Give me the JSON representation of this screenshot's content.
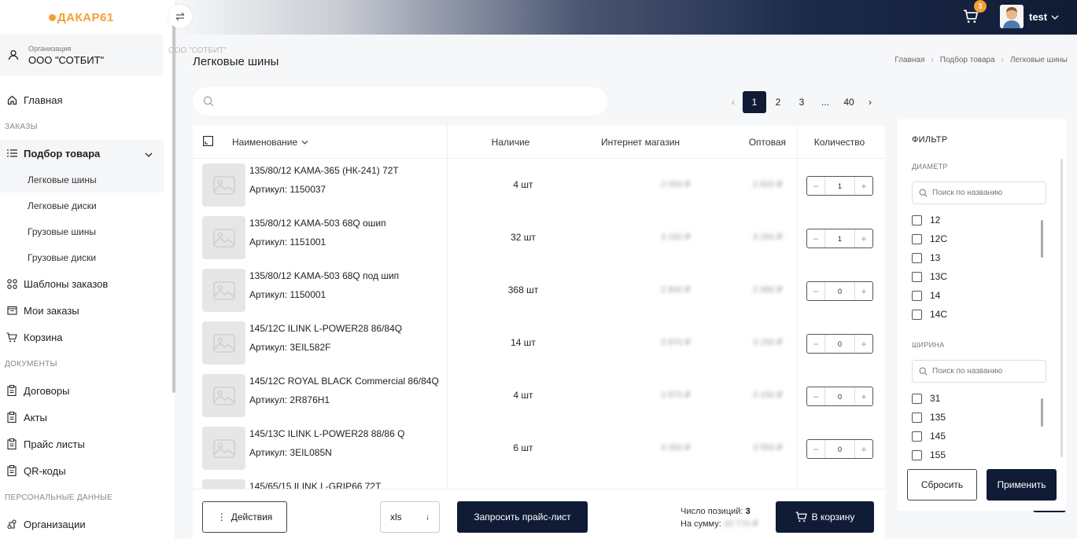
{
  "brand": {
    "logo": "ДАКАР61"
  },
  "organization": {
    "label": "Организация",
    "name": "ООО \"СОТБИТ\"",
    "ghost": "ООО \"СОТБИТ\""
  },
  "nav": {
    "home": "Главная",
    "section_orders": "ЗАКАЗЫ",
    "product_selection": "Подбор товара",
    "sub": [
      "Легковые шины",
      "Легковые диски",
      "Грузовые шины",
      "Грузовые диски"
    ],
    "order_templates": "Шаблоны заказов",
    "my_orders": "Мои заказы",
    "cart": "Корзина",
    "section_docs": "ДОКУМЕНТЫ",
    "contracts": "Договоры",
    "acts": "Акты",
    "price_lists": "Прайс листы",
    "qr_codes": "QR-коды",
    "section_personal": "ПЕРСОНАЛЬНЫЕ ДАННЫЕ",
    "organizations": "Организации"
  },
  "header": {
    "cart_count": "3",
    "user": "test"
  },
  "page": {
    "title": "Легковые шины",
    "breadcrumb": [
      "Главная",
      "Подбор товара",
      "Легковые шины"
    ]
  },
  "pagination": {
    "pages": [
      "1",
      "2",
      "3",
      "...",
      "40"
    ],
    "active": "1"
  },
  "table": {
    "headers": {
      "name": "Наименование",
      "availability": "Наличие",
      "shop": "Интернет магазин",
      "wholesale": "Оптовая",
      "quantity": "Количество"
    },
    "rows": [
      {
        "name": "135/80/12 KAMA-365 (НК-241) 72T",
        "article": "Артикул: 1150037",
        "availability": "4 шт",
        "price_shop": "2 050 ₽",
        "price_wholesale": "2 820 ₽",
        "qty": "1"
      },
      {
        "name": "135/80/12 KAMA-503 68Q ошип",
        "article": "Артикул: 1151001",
        "availability": "32 шт",
        "price_shop": "3 150 ₽",
        "price_wholesale": "3 250 ₽",
        "qty": "1"
      },
      {
        "name": "135/80/12 KAMA-503 68Q под шип",
        "article": "Артикул: 1150001",
        "availability": "368 шт",
        "price_shop": "2 800 ₽",
        "price_wholesale": "2 990 ₽",
        "qty": "0"
      },
      {
        "name": "145/12C ILINK L-POWER28 86/84Q",
        "article": "Артикул: 3EIL582F",
        "availability": "14 шт",
        "price_shop": "3 870 ₽",
        "price_wholesale": "3 150 ₽",
        "qty": "0"
      },
      {
        "name": "145/12C ROYAL BLACK Commercial 86/84Q",
        "article": "Артикул: 2R876H1",
        "availability": "4 шт",
        "price_shop": "3 870 ₽",
        "price_wholesale": "3 150 ₽",
        "qty": "0"
      },
      {
        "name": "145/13C ILINK L-POWER28 88/86 Q",
        "article": "Артикул: 3EIL085N",
        "availability": "6 шт",
        "price_shop": "4 050 ₽",
        "price_wholesale": "3 550 ₽",
        "qty": "0"
      },
      {
        "name": "145/65/15 ILINK L-GRIP66 72T",
        "article": "",
        "availability": "",
        "price_shop": "",
        "price_wholesale": "",
        "qty": ""
      }
    ]
  },
  "bottom": {
    "actions": "Действия",
    "format": "xls",
    "request_price": "Запросить прайс-лист",
    "positions_label": "Число позиций:",
    "positions_value": "3",
    "sum_label": "На сумму:",
    "sum_value": "20 770 ₽",
    "to_cart": "В корзину"
  },
  "filter": {
    "title": "ФИЛЬТР",
    "diameter": "ДИАМЕТР",
    "width": "ШИРИНА",
    "search_placeholder": "Поиск по названию",
    "diameter_options": [
      "12",
      "12C",
      "13",
      "13C",
      "14",
      "14C"
    ],
    "width_options": [
      "31",
      "135",
      "145",
      "155"
    ],
    "reset": "Сбросить",
    "apply": "Применить"
  },
  "colors": {
    "primary": "#101b35",
    "accent": "#f5a033"
  }
}
